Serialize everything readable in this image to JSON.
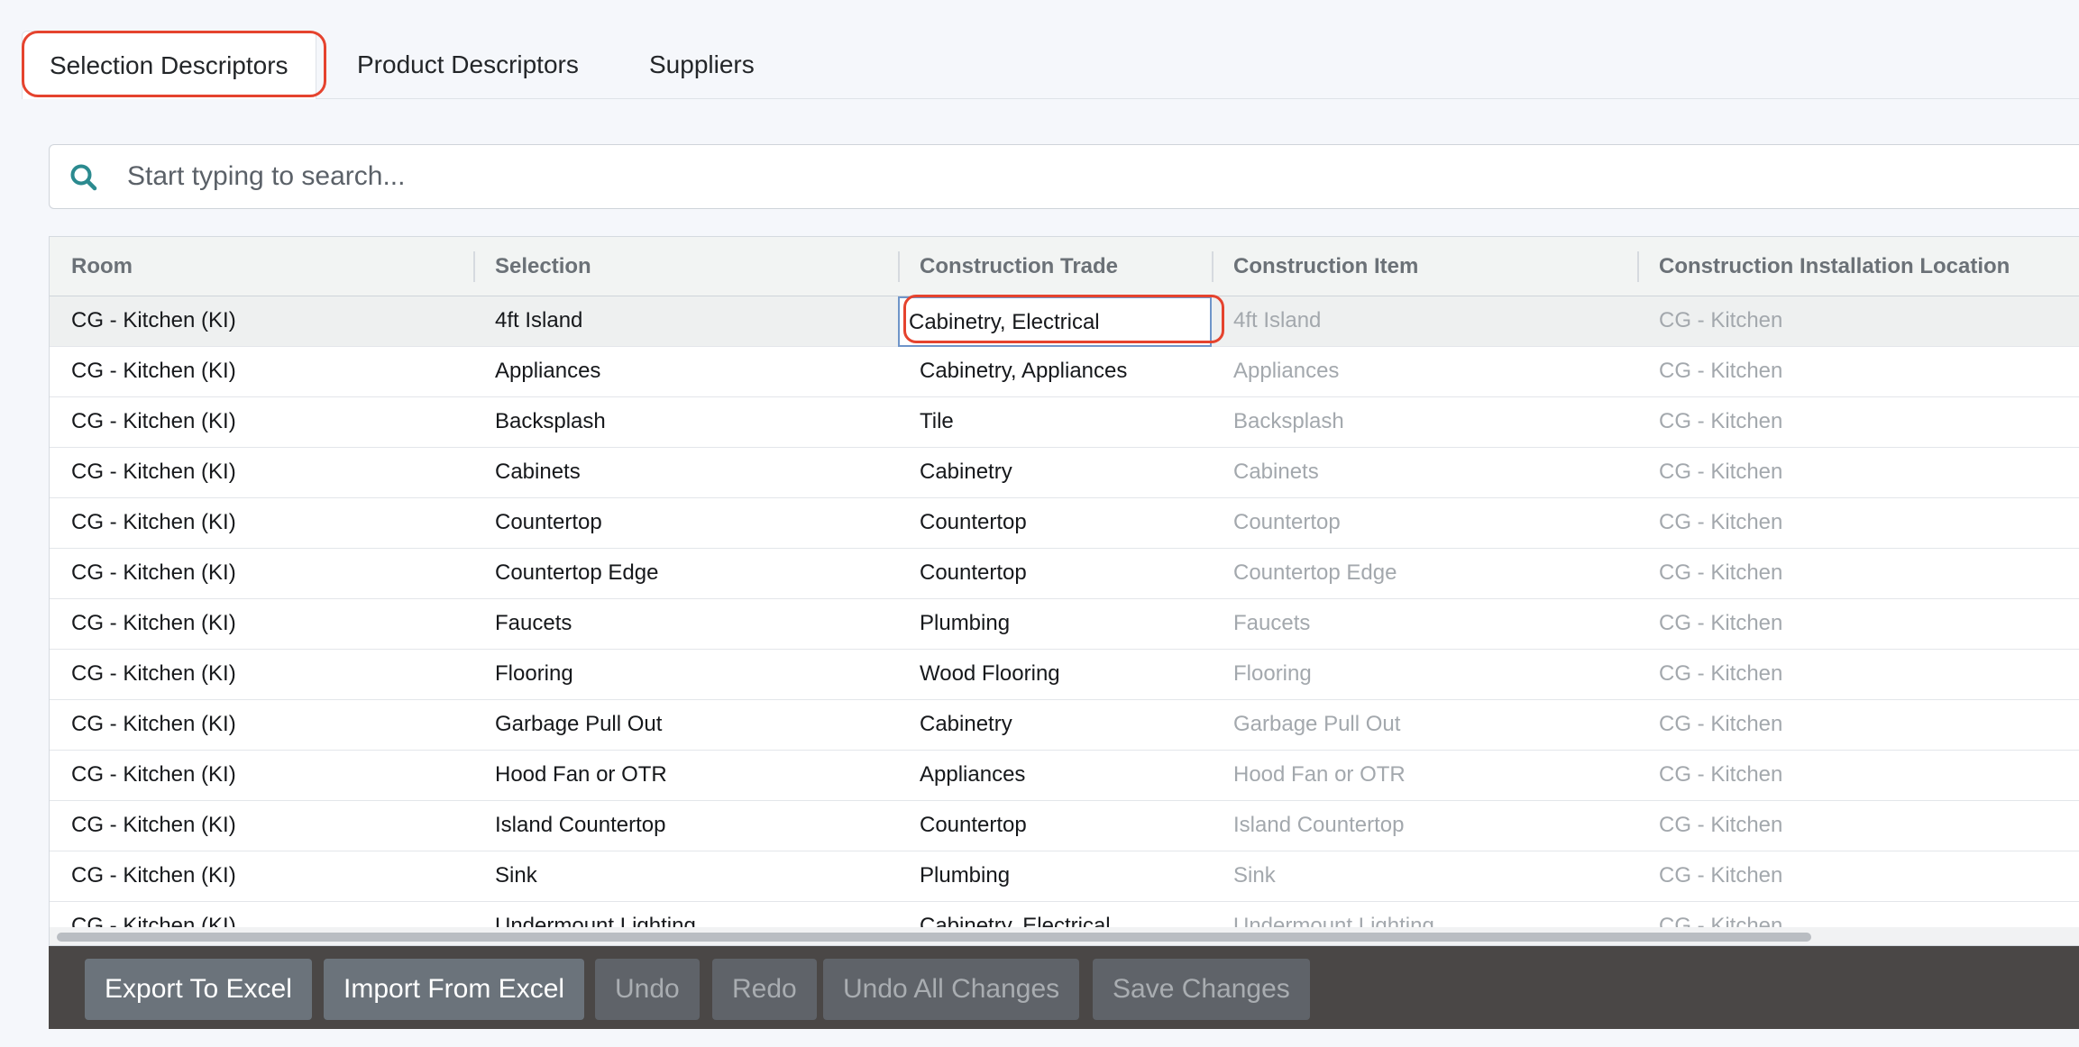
{
  "tabs": [
    {
      "label": "Selection Descriptors",
      "active": true
    },
    {
      "label": "Product Descriptors",
      "active": false
    },
    {
      "label": "Suppliers",
      "active": false
    }
  ],
  "search": {
    "placeholder": "Start typing to search...",
    "value": "",
    "icon": "search-icon"
  },
  "grid": {
    "columns": [
      "Room",
      "Selection",
      "Construction Trade",
      "Construction Item",
      "Construction Installation Location"
    ],
    "rows": [
      [
        "CG - Kitchen (KI)",
        "4ft Island",
        "Cabinetry, Electrical",
        "4ft Island",
        "CG - Kitchen"
      ],
      [
        "CG - Kitchen (KI)",
        "Appliances",
        "Cabinetry, Appliances",
        "Appliances",
        "CG - Kitchen"
      ],
      [
        "CG - Kitchen (KI)",
        "Backsplash",
        "Tile",
        "Backsplash",
        "CG - Kitchen"
      ],
      [
        "CG - Kitchen (KI)",
        "Cabinets",
        "Cabinetry",
        "Cabinets",
        "CG - Kitchen"
      ],
      [
        "CG - Kitchen (KI)",
        "Countertop",
        "Countertop",
        "Countertop",
        "CG - Kitchen"
      ],
      [
        "CG - Kitchen (KI)",
        "Countertop Edge",
        "Countertop",
        "Countertop Edge",
        "CG - Kitchen"
      ],
      [
        "CG - Kitchen (KI)",
        "Faucets",
        "Plumbing",
        "Faucets",
        "CG - Kitchen"
      ],
      [
        "CG - Kitchen (KI)",
        "Flooring",
        "Wood Flooring",
        "Flooring",
        "CG - Kitchen"
      ],
      [
        "CG - Kitchen (KI)",
        "Garbage Pull Out",
        "Cabinetry",
        "Garbage Pull Out",
        "CG - Kitchen"
      ],
      [
        "CG - Kitchen (KI)",
        "Hood Fan or OTR",
        "Appliances",
        "Hood Fan or OTR",
        "CG - Kitchen"
      ],
      [
        "CG - Kitchen (KI)",
        "Island Countertop",
        "Countertop",
        "Island Countertop",
        "CG - Kitchen"
      ],
      [
        "CG - Kitchen (KI)",
        "Sink",
        "Plumbing",
        "Sink",
        "CG - Kitchen"
      ],
      [
        "CG - Kitchen (KI)",
        "Undermount Lighting",
        "Cabinetry, Electrical",
        "Undermount Lighting",
        "CG - Kitchen"
      ]
    ]
  },
  "toolbar": {
    "export_label": "Export To Excel",
    "import_label": "Import From Excel",
    "undo_label": "Undo",
    "redo_label": "Redo",
    "undo_all_label": "Undo All Changes",
    "save_label": "Save Changes"
  },
  "colors": {
    "accent": "#2b8a8f",
    "annotation": "#e5432e",
    "toolbar_bg": "#4a4746"
  }
}
